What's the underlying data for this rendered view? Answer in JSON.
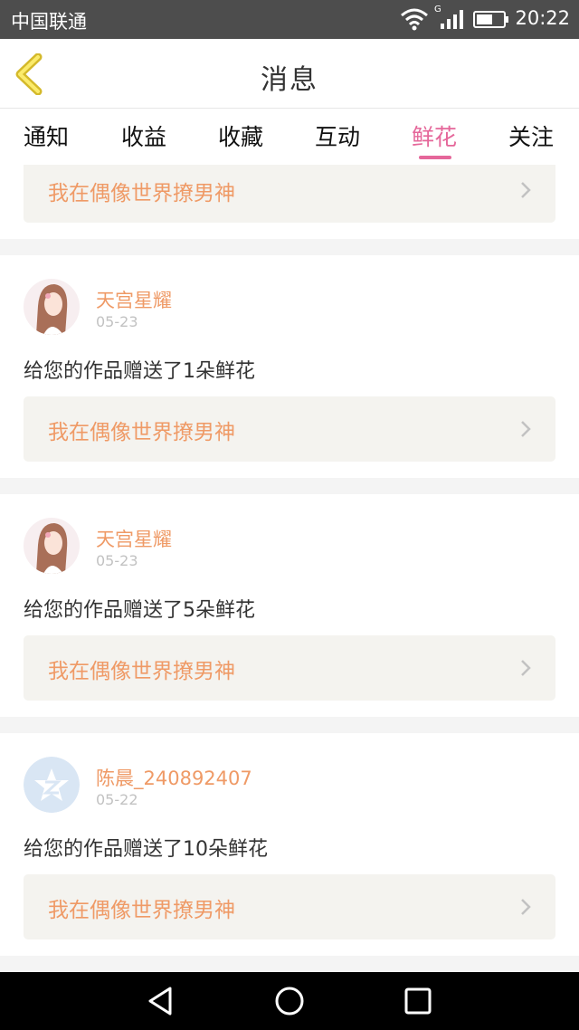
{
  "status_bar": {
    "carrier": "中国联通",
    "network": "G",
    "time": "20:22"
  },
  "header": {
    "title": "消息"
  },
  "tabs": [
    {
      "label": "通知",
      "active": false
    },
    {
      "label": "收益",
      "active": false
    },
    {
      "label": "收藏",
      "active": false
    },
    {
      "label": "互动",
      "active": false
    },
    {
      "label": "鲜花",
      "active": true
    },
    {
      "label": "关注",
      "active": false
    }
  ],
  "top_partial": {
    "work_title": "我在偶像世界撩男神"
  },
  "messages": [
    {
      "user": "天宫星耀",
      "date": "05-23",
      "text": "给您的作品赠送了1朵鲜花",
      "work_title": "我在偶像世界撩男神",
      "avatar": "girl-photo"
    },
    {
      "user": "天宫星耀",
      "date": "05-23",
      "text": "给您的作品赠送了5朵鲜花",
      "work_title": "我在偶像世界撩男神",
      "avatar": "girl-photo"
    },
    {
      "user": "陈晨_240892407",
      "date": "05-22",
      "text": "给您的作品赠送了10朵鲜花",
      "work_title": "我在偶像世界撩男神",
      "avatar": "qq-default-avatar"
    }
  ],
  "colors": {
    "accent_pink": "#e5679a",
    "name_orange": "#ef9a66",
    "status_bar": "#4d4d4d"
  },
  "nav_icons": [
    "back-triangle-icon",
    "home-circle-icon",
    "recent-square-icon"
  ]
}
